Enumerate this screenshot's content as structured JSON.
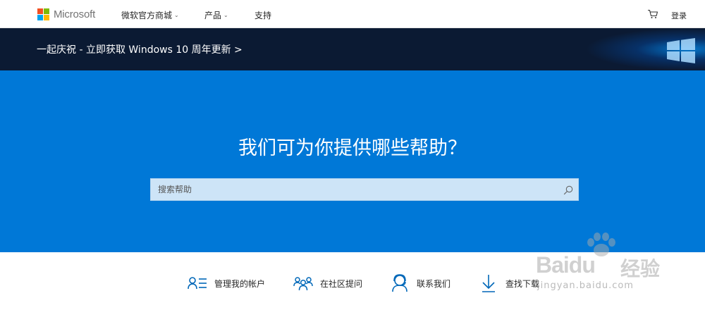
{
  "header": {
    "brand": "Microsoft",
    "logo_colors": [
      "#f25022",
      "#7fba00",
      "#00a4ef",
      "#ffb900"
    ],
    "nav": [
      {
        "label": "微软官方商城",
        "has_dropdown": true
      },
      {
        "label": "产品",
        "has_dropdown": true
      },
      {
        "label": "支持",
        "has_dropdown": false
      }
    ],
    "cart_icon": "cart-icon",
    "login_label": "登录"
  },
  "promo": {
    "text": "一起庆祝 - 立即获取 Windows 10 周年更新 >"
  },
  "hero": {
    "title": "我们可为你提供哪些帮助？",
    "search": {
      "placeholder": "搜索帮助",
      "value": "",
      "icon": "search-icon"
    },
    "background": "#0078d7"
  },
  "quick_links": [
    {
      "label": "管理我的帐户",
      "icon": "account-list-icon"
    },
    {
      "label": "在社区提问",
      "icon": "community-icon"
    },
    {
      "label": "联系我们",
      "icon": "headset-icon"
    },
    {
      "label": "查找下载",
      "icon": "download-icon"
    }
  ],
  "watermark": {
    "brand": "Baidu",
    "brand_cn": "经验",
    "url": "jingyan.baidu.com"
  },
  "colors": {
    "accent": "#0078d7",
    "promo_bg": "#0b1a33",
    "icon_blue": "#0067b8"
  }
}
